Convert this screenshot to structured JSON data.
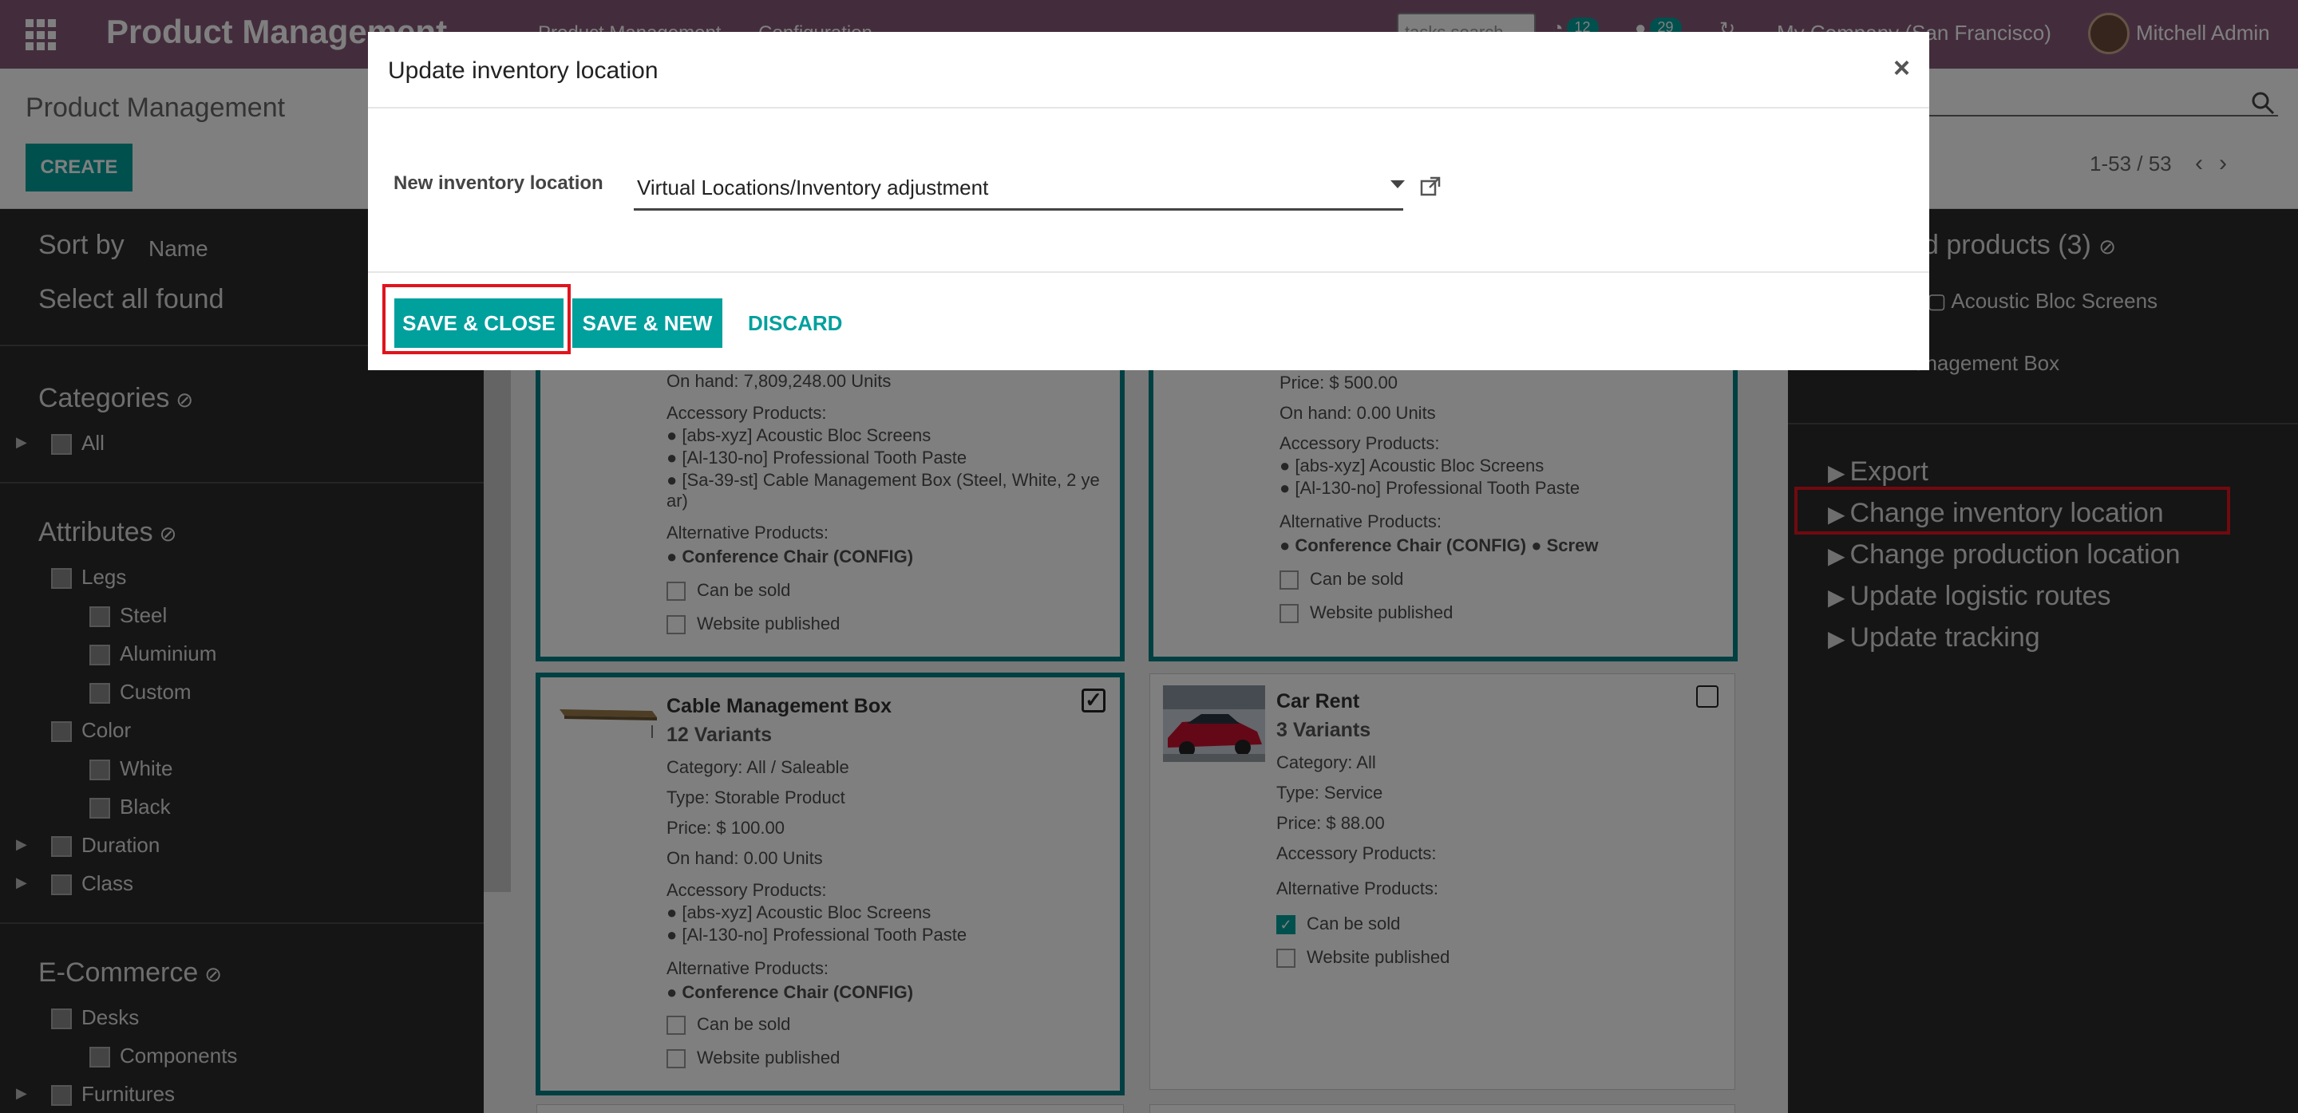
{
  "navbar": {
    "brand": "Product Management",
    "menu": [
      "Product Management",
      "Configuration"
    ],
    "search_placeholder": "tasks search",
    "activity_count": "12",
    "message_count": "29",
    "company": "My Company (San Francisco)",
    "user": "Mitchell Admin"
  },
  "control_panel": {
    "breadcrumb": "Product Management",
    "create_label": "CREATE",
    "pager": "1-53 / 53"
  },
  "left_panel": {
    "sort_by_label": "Sort by",
    "sort_by_value": "Name",
    "select_all_label": "Select all found",
    "sections": [
      {
        "title": "Categories",
        "items": [
          {
            "label": "All"
          }
        ]
      },
      {
        "title": "Attributes",
        "items": [
          {
            "label": "Legs"
          },
          {
            "label": "Steel"
          },
          {
            "label": "Aluminium"
          },
          {
            "label": "Custom"
          },
          {
            "label": "Color"
          },
          {
            "label": "White"
          },
          {
            "label": "Black"
          },
          {
            "label": "Duration"
          },
          {
            "label": "Class"
          }
        ]
      },
      {
        "title": "E-Commerce",
        "items": [
          {
            "label": "Desks"
          },
          {
            "label": "Components"
          },
          {
            "label": "Furnitures"
          }
        ]
      }
    ]
  },
  "cards": {
    "top_left": {
      "onhand": "On hand: 7,809,248.00 Units",
      "accessory_label": "Accessory Products:",
      "accessories": [
        "[abs-xyz] Acoustic Bloc Screens",
        "[Al-130-no] Professional Tooth Paste",
        "[Sa-39-st] Cable Management Box (Steel, White, 2 ye",
        "ar)"
      ],
      "alternative_label": "Alternative Products:",
      "alternatives": "Conference Chair (CONFIG)",
      "can_be_sold": "Can be sold",
      "website_published": "Website published"
    },
    "top_right": {
      "price": "Price: $ 500.00",
      "onhand": "On hand: 0.00 Units",
      "accessory_label": "Accessory Products:",
      "accessories": [
        "[abs-xyz] Acoustic Bloc Screens",
        "[Al-130-no] Professional Tooth Paste"
      ],
      "alternative_label": "Alternative Products:",
      "alternatives_a": "Conference Chair (CONFIG)",
      "alternatives_b": "Screw",
      "can_be_sold": "Can be sold",
      "website_published": "Website published"
    },
    "cable_box": {
      "title": "Cable Management Box",
      "variants": "12 Variants",
      "category": "Category: All / Saleable",
      "type": "Type: Storable Product",
      "price": "Price: $ 100.00",
      "onhand": "On hand: 0.00 Units",
      "accessory_label": "Accessory Products:",
      "accessories": [
        "[abs-xyz] Acoustic Bloc Screens",
        "[Al-130-no] Professional Tooth Paste"
      ],
      "alternative_label": "Alternative Products:",
      "alternatives": "Conference Chair (CONFIG)",
      "can_be_sold": "Can be sold",
      "website_published": "Website published",
      "selected": true
    },
    "car_rent": {
      "title": "Car Rent",
      "variants": "3 Variants",
      "category": "Category: All",
      "type": "Type: Service",
      "price": "Price: $ 88.00",
      "accessory_label": "Accessory Products:",
      "alternative_label": "Alternative Products:",
      "can_be_sold": "Can be sold",
      "website_published": "Website published",
      "selected": false
    }
  },
  "right_panel": {
    "title": "d products (3)",
    "selected_items": [
      "Acoustic Bloc Screens",
      "anagement Box"
    ],
    "actions": [
      "Export",
      "Change inventory location",
      "Change production location",
      "Update logistic routes",
      "Update tracking"
    ]
  },
  "modal": {
    "title": "Update inventory location",
    "close_label": "×",
    "field_label": "New inventory location",
    "field_value": "Virtual Locations/Inventory adjustment",
    "save_close_label": "SAVE & CLOSE",
    "save_new_label": "SAVE & NEW",
    "discard_label": "DISCARD"
  },
  "colors": {
    "navbar": "#875a7b",
    "primary": "#00a09d",
    "sidebar": "#2b2b2b",
    "highlight": "#e0141e"
  }
}
